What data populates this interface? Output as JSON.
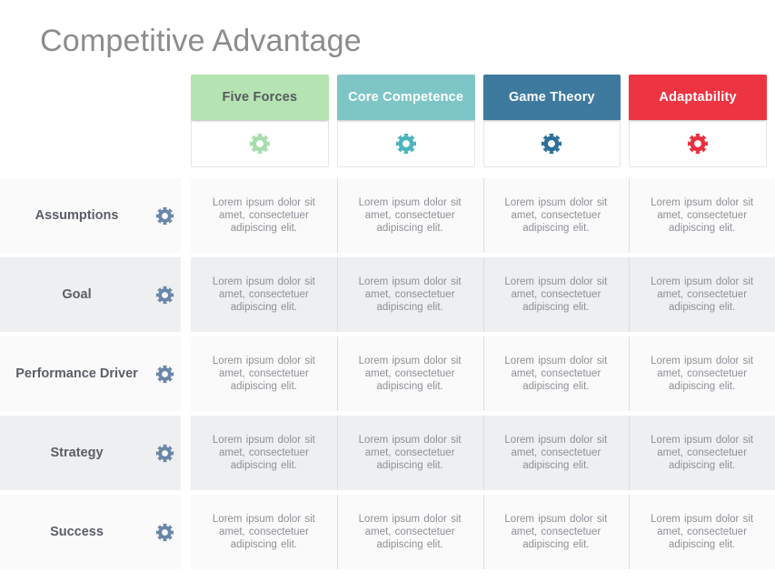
{
  "slide": {
    "title": "Competitive Advantage",
    "title_color": "#8c8c8c",
    "background": "#ffffff"
  },
  "columns": [
    {
      "label": "Five Forces",
      "band_color": "#b6e3b2",
      "label_color": "#555a5e",
      "icon": "gear-icon",
      "icon_color": "#a7ddaa"
    },
    {
      "label": "Core Competence",
      "band_color": "#7ec6c6",
      "label_color": "#ffffff",
      "icon": "gear-icon",
      "icon_color": "#4cb3bd"
    },
    {
      "label": "Game Theory",
      "band_color": "#3d7a9e",
      "label_color": "#ffffff",
      "icon": "gear-icon",
      "icon_color": "#2d6f99"
    },
    {
      "label": "Adaptability",
      "band_color": "#ec3443",
      "label_color": "#ffffff",
      "icon": "gear-icon",
      "icon_color": "#e8303f"
    }
  ],
  "rows": [
    {
      "label": "Assumptions",
      "icon": "gear-icon",
      "icon_color": "#6a87a8",
      "shade": "norm",
      "cells": [
        "Lorem ipsum dolor sit amet, consectetuer adipiscing elit.",
        "Lorem ipsum dolor sit amet, consectetuer adipiscing elit.",
        "Lorem ipsum dolor sit amet, consectetuer adipiscing elit.",
        "Lorem ipsum dolor sit amet, consectetuer adipiscing elit."
      ]
    },
    {
      "label": "Goal",
      "icon": "gear-icon",
      "icon_color": "#6a87a8",
      "shade": "alt",
      "cells": [
        "Lorem ipsum dolor sit amet, consectetuer adipiscing elit.",
        "Lorem ipsum dolor sit amet, consectetuer adipiscing elit.",
        "Lorem ipsum dolor sit amet, consectetuer adipiscing elit.",
        "Lorem ipsum dolor sit amet, consectetuer adipiscing elit."
      ]
    },
    {
      "label": "Performance Driver",
      "icon": "gear-icon",
      "icon_color": "#6a87a8",
      "shade": "norm",
      "cells": [
        "Lorem ipsum dolor sit amet, consectetuer adipiscing elit.",
        "Lorem ipsum dolor sit amet, consectetuer adipiscing elit.",
        "Lorem ipsum dolor sit amet, consectetuer adipiscing elit.",
        "Lorem ipsum dolor sit amet, consectetuer adipiscing elit."
      ]
    },
    {
      "label": "Strategy",
      "icon": "gear-icon",
      "icon_color": "#6a87a8",
      "shade": "alt",
      "cells": [
        "Lorem ipsum dolor sit amet, consectetuer adipiscing elit.",
        "Lorem ipsum dolor sit amet, consectetuer adipiscing elit.",
        "Lorem ipsum dolor sit amet, consectetuer adipiscing elit.",
        "Lorem ipsum dolor sit amet, consectetuer adipiscing elit."
      ]
    },
    {
      "label": "Success",
      "icon": "gear-icon",
      "icon_color": "#6a87a8",
      "shade": "norm",
      "cells": [
        "Lorem ipsum dolor sit amet, consectetuer adipiscing elit.",
        "Lorem ipsum dolor sit amet, consectetuer adipiscing elit.",
        "Lorem ipsum dolor sit amet, consectetuer adipiscing elit.",
        "Lorem ipsum dolor sit amet, consectetuer adipiscing elit."
      ]
    }
  ]
}
